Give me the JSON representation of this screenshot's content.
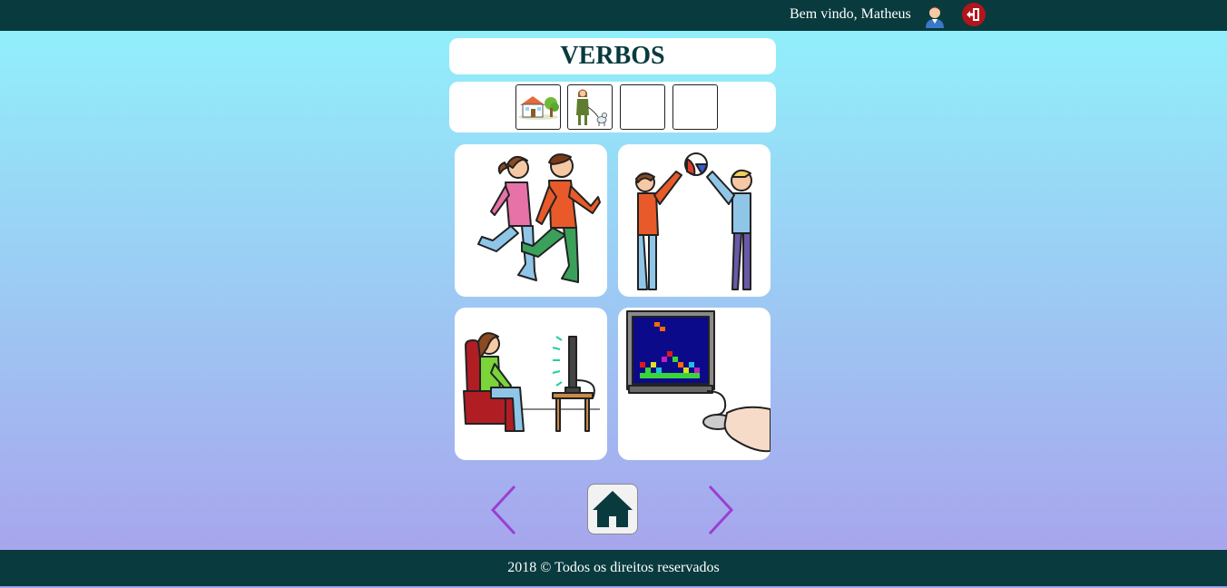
{
  "header": {
    "welcome_text": "Bem vindo, Matheus",
    "user_icon": "user-avatar-icon",
    "exit_icon": "exit-door-icon"
  },
  "title": "VERBOS",
  "sentence_slots": [
    {
      "icon": "house-icon",
      "filled": true
    },
    {
      "icon": "woman-with-dog-icon",
      "filled": true
    },
    {
      "icon": "",
      "filled": false
    },
    {
      "icon": "",
      "filled": false
    }
  ],
  "cards": [
    {
      "icon": "running-people-icon"
    },
    {
      "icon": "playing-ball-icon"
    },
    {
      "icon": "watching-tv-icon"
    },
    {
      "icon": "video-game-icon"
    }
  ],
  "navigation": {
    "prev_icon": "chevron-left-icon",
    "home_icon": "home-icon",
    "next_icon": "chevron-right-icon"
  },
  "footer": {
    "text": "2018 © Todos os direitos reservados"
  },
  "colors": {
    "header_bg": "#083a3e",
    "title_color": "#083a3e",
    "gradient_top": "#90f3fb",
    "gradient_bottom": "#a9a0ec",
    "arrow_color": "#9a3fd0",
    "exit_color": "#b0161c"
  }
}
